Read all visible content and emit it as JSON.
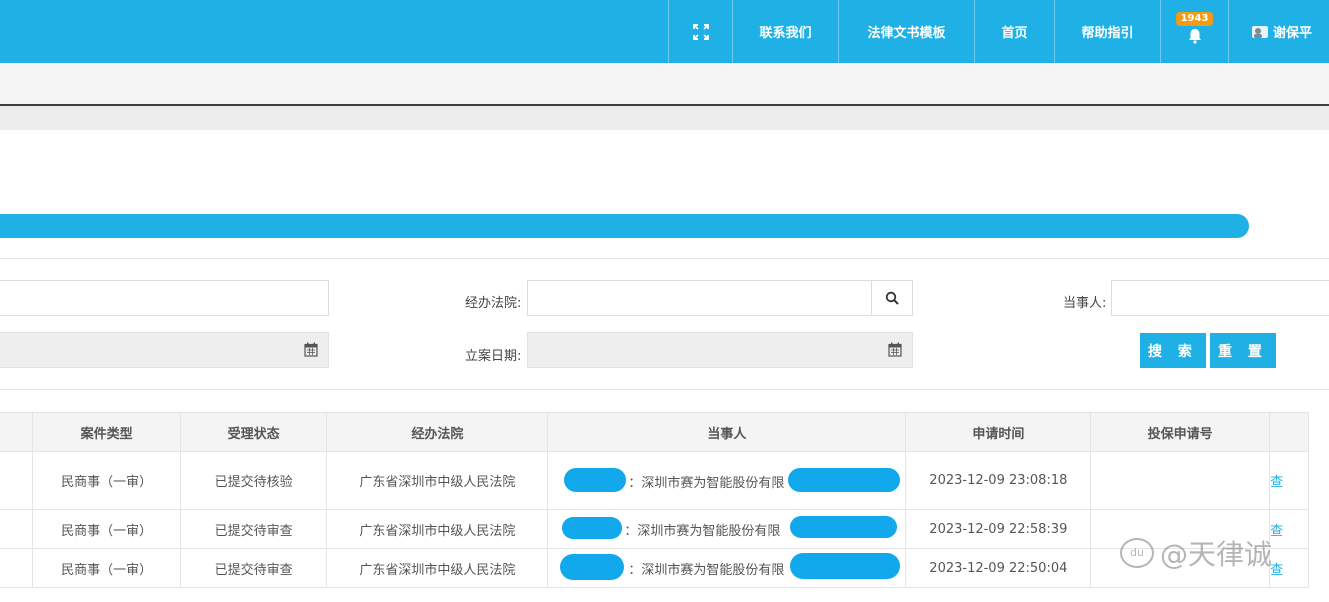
{
  "header": {
    "nav": [
      {
        "label": "",
        "icon": "fullscreen-icon"
      },
      {
        "label": "联系我们"
      },
      {
        "label": "法律文书模板"
      },
      {
        "label": "首页"
      },
      {
        "label": "帮助指引"
      },
      {
        "label": "",
        "icon": "bell-icon",
        "badge": "1943"
      },
      {
        "label": "谢保平",
        "icon": "user-icon"
      }
    ],
    "accent_color": "#1fb1e6"
  },
  "search": {
    "court_label": "经办法院:",
    "party_label": "当事人:",
    "date_label": "立案日期:",
    "search_button": "搜 索",
    "reset_button": "重 置"
  },
  "table": {
    "headers": [
      "案件类型",
      "受理状态",
      "经办法院",
      "当事人",
      "申请时间",
      "投保申请号",
      ""
    ],
    "rows": [
      {
        "type": "民商事（一审）",
        "status": "已提交待核验",
        "court": "广东省深圳市中级人民法院",
        "party": "：深圳市赛为智能股份有限",
        "time": "2023-12-09 23:08:18",
        "app_no": "",
        "action": "查"
      },
      {
        "type": "民商事（一审）",
        "status": "已提交待审查",
        "court": "广东省深圳市中级人民法院",
        "party": "：深圳市赛为智能股份有限",
        "time": "2023-12-09 22:58:39",
        "app_no": "",
        "action": "查"
      },
      {
        "type": "民商事（一审）",
        "status": "已提交待审查",
        "court": "广东省深圳市中级人民法院",
        "party": "：深圳市赛为智能股份有限",
        "time": "2023-12-09 22:50:04",
        "app_no": "",
        "action": "查"
      }
    ]
  },
  "watermark": {
    "logo": "du",
    "text": "@天律诚"
  }
}
